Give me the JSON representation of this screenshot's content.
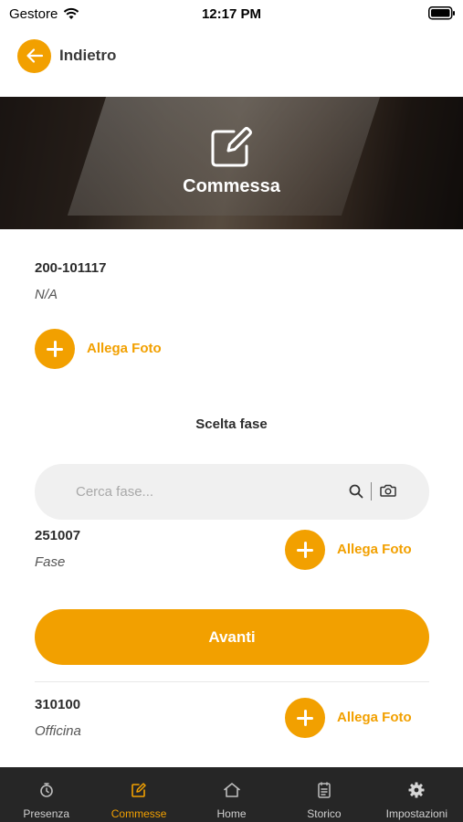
{
  "status_bar": {
    "carrier": "Gestore",
    "time": "12:17 PM"
  },
  "header": {
    "back_label": "Indietro"
  },
  "hero": {
    "title": "Commessa"
  },
  "commessa": {
    "code": "200-101117",
    "description": "N/A",
    "attach_label": "Allega Foto"
  },
  "phase_section": {
    "title": "Scelta fase"
  },
  "search": {
    "placeholder": "Cerca fase...",
    "value": ""
  },
  "phases": [
    {
      "code": "251007",
      "description": "Fase",
      "attach_label": "Allega Foto"
    },
    {
      "code": "310100",
      "description": "Officina",
      "attach_label": "Allega Foto"
    }
  ],
  "primary_button": {
    "label": "Avanti"
  },
  "tabs": [
    {
      "label": "Presenza",
      "icon": "clock-icon",
      "active": false
    },
    {
      "label": "Commesse",
      "icon": "edit-icon",
      "active": true
    },
    {
      "label": "Home",
      "icon": "home-icon",
      "active": false
    },
    {
      "label": "Storico",
      "icon": "history-icon",
      "active": false
    },
    {
      "label": "Impostazioni",
      "icon": "gear-icon",
      "active": false
    }
  ],
  "colors": {
    "accent": "#f2a000",
    "tab_bar": "#262626",
    "search_bg": "#f0f0f0"
  }
}
